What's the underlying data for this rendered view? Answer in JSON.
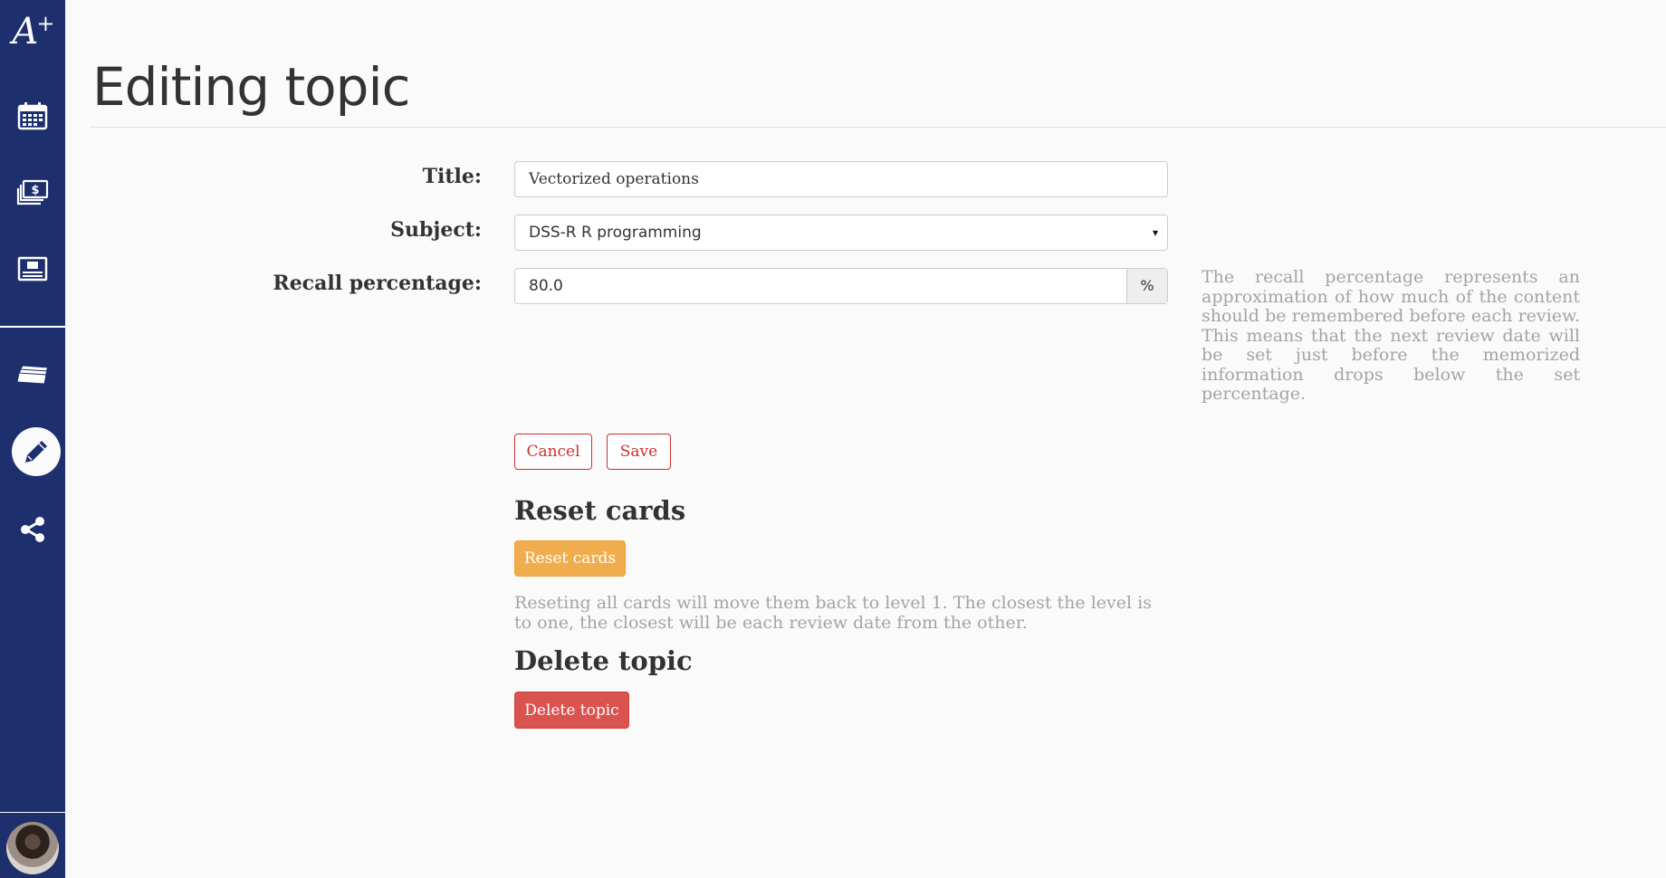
{
  "app": {
    "logo_text": "A",
    "logo_sup": "+"
  },
  "sidebar": {
    "icons": [
      "calendar-icon",
      "money-stack-icon",
      "card-icon",
      "cards-stack-icon",
      "pencil-icon",
      "share-icon"
    ],
    "active": "pencil-icon",
    "background": "#1e2f6e"
  },
  "page": {
    "title": "Editing topic"
  },
  "form": {
    "title_label": "Title:",
    "title_value": "Vectorized operations",
    "subject_label": "Subject:",
    "subject_value": "DSS-R R programming",
    "subject_caret": "▾",
    "recall_label": "Recall percentage:",
    "recall_value": "80.0",
    "recall_addon": "%",
    "recall_help": "The recall percentage represents an approximation of how much of the content should be remembered before each review. This means that the next review date will be set just before the memorized information drops below the set percentage."
  },
  "actions": {
    "cancel_label": "Cancel",
    "save_label": "Save"
  },
  "reset": {
    "heading": "Reset cards",
    "button_label": "Reset cards",
    "note": "Reseting all cards will move them back to level 1. The closest the level is to one, the closest will be each review date from the other."
  },
  "delete": {
    "heading": "Delete topic",
    "button_label": "Delete topic"
  },
  "colors": {
    "danger": "#d9534f",
    "warning": "#f0ad4e",
    "outline_red": "#c9302c"
  }
}
